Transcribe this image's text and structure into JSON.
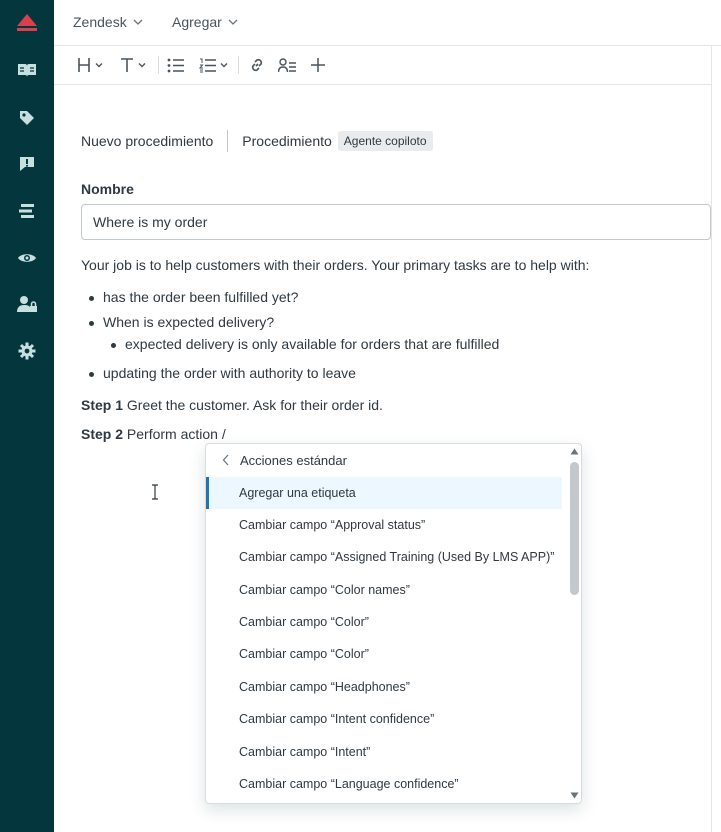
{
  "rail": {
    "background": "#03363d",
    "accent": "#d93f4c",
    "items": [
      "knowledge-icon",
      "tag-icon",
      "alert-icon",
      "list-icon",
      "eye-icon",
      "user-lock-icon",
      "gear-icon"
    ]
  },
  "topbar": {
    "product_menu": "Zendesk",
    "add_menu": "Agregar"
  },
  "toolbar": {
    "items": [
      "heading-icon",
      "text-icon",
      "bullet-list-icon",
      "numbered-list-icon",
      "link-icon",
      "placeholder-icon",
      "add-icon"
    ]
  },
  "breadcrumb": {
    "item1": "Nuevo procedimiento",
    "item2": "Procedimiento",
    "badge": "Agente copiloto"
  },
  "form": {
    "name_label": "Nombre",
    "name_value": "Where is my order"
  },
  "content": {
    "intro": "Your job is to help customers with their orders. Your primary tasks are to help with:",
    "bullet1": "has the order been fulfilled yet?",
    "bullet2": "When is expected delivery?",
    "bullet2_sub": "expected delivery is only available for orders that are fulfilled",
    "bullet3": "updating the order with authority to leave",
    "step1_label": "Step 1",
    "step1_text": " Greet the customer. Ask for their order id.",
    "step2_label": "Step 2",
    "step2_text": " Perform action /"
  },
  "dropdown": {
    "header": "Acciones estándar",
    "items": [
      "Agregar una etiqueta",
      "Cambiar campo “Approval status”",
      "Cambiar campo “Assigned Training (Used By LMS APP)”",
      "Cambiar campo “Color names”",
      "Cambiar campo “Color”",
      "Cambiar campo “Color”",
      "Cambiar campo “Headphones”",
      "Cambiar campo “Intent confidence”",
      "Cambiar campo “Intent”",
      "Cambiar campo “Language confidence”"
    ],
    "active_color": "#1f73b7"
  }
}
